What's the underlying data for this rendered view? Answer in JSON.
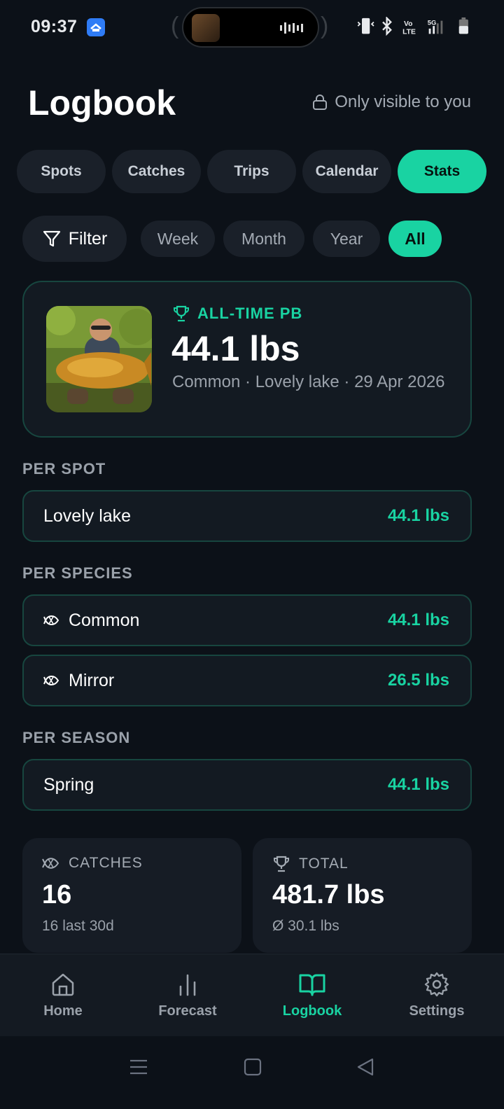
{
  "status_bar": {
    "time": "09:37",
    "network": "5G",
    "volte": "Vo LTE"
  },
  "header": {
    "title": "Logbook",
    "visibility": "Only visible to you"
  },
  "tabs": [
    {
      "label": "Spots",
      "active": false
    },
    {
      "label": "Catches",
      "active": false
    },
    {
      "label": "Trips",
      "active": false
    },
    {
      "label": "Calendar",
      "active": false
    },
    {
      "label": "Stats",
      "active": true
    }
  ],
  "filters": {
    "filter_label": "Filter",
    "periods": [
      {
        "label": "Week",
        "active": false
      },
      {
        "label": "Month",
        "active": false
      },
      {
        "label": "Year",
        "active": false
      },
      {
        "label": "All",
        "active": true
      }
    ]
  },
  "pb": {
    "label": "ALL-TIME PB",
    "weight": "44.1 lbs",
    "meta": "Common · Lovely lake · 29 Apr 2026"
  },
  "per_spot": {
    "title": "PER SPOT",
    "items": [
      {
        "name": "Lovely lake",
        "value": "44.1 lbs"
      }
    ]
  },
  "per_species": {
    "title": "PER SPECIES",
    "items": [
      {
        "name": "Common",
        "value": "44.1 lbs"
      },
      {
        "name": "Mirror",
        "value": "26.5 lbs"
      }
    ]
  },
  "per_season": {
    "title": "PER SEASON",
    "items": [
      {
        "name": "Spring",
        "value": "44.1 lbs"
      }
    ]
  },
  "stats": {
    "catches": {
      "label": "CATCHES",
      "value": "16",
      "sub": "16 last 30d"
    },
    "total": {
      "label": "TOTAL",
      "value": "481.7 lbs",
      "sub": "Ø 30.1 lbs"
    }
  },
  "nav": [
    {
      "label": "Home",
      "icon": "home-icon",
      "active": false
    },
    {
      "label": "Forecast",
      "icon": "bar-chart-icon",
      "active": false
    },
    {
      "label": "Logbook",
      "icon": "book-icon",
      "active": true
    },
    {
      "label": "Settings",
      "icon": "gear-icon",
      "active": false
    }
  ],
  "colors": {
    "accent": "#19d3a2",
    "background": "#0c1118",
    "card": "#131a22",
    "card_border": "#17463f"
  }
}
